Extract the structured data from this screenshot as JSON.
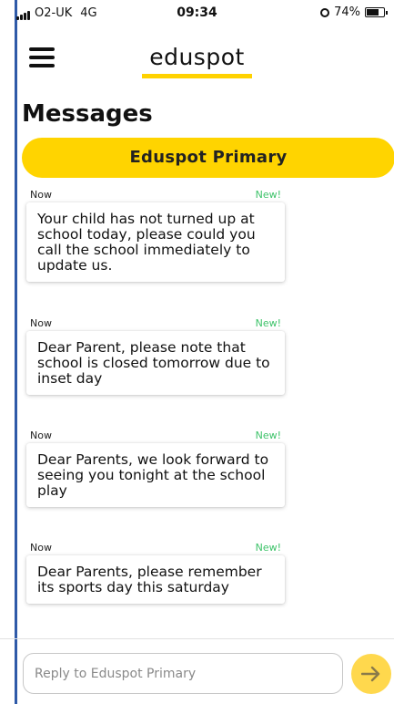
{
  "status_bar": {
    "carrier": "O2-UK",
    "network": "4G",
    "time": "09:34",
    "battery": "74%",
    "battery_level": 0.74
  },
  "header": {
    "logo": "eduspot",
    "menu_icon": "hamburger-menu-icon"
  },
  "page": {
    "title": "Messages",
    "school_name": "Eduspot Primary"
  },
  "messages": [
    {
      "time": "Now",
      "badge": "New!",
      "text": "Your child has not turned up at school today, please could you call the school immediate­ly to update us."
    },
    {
      "time": "Now",
      "badge": "New!",
      "text": "Dear Parent, please note that school is closed tomorrow due to inset day"
    },
    {
      "time": "Now",
      "badge": "New!",
      "text": "Dear Parents, we look for­ward to seeing you tonight at the school play"
    },
    {
      "time": "Now",
      "badge": "New!",
      "text": "Dear Parents, please remem­ber its sports day this satur­day"
    }
  ],
  "reply": {
    "placeholder": "Reply to Eduspot Primary",
    "value": "",
    "send_icon": "arrow-right-icon"
  },
  "colors": {
    "accent": "#ffd400",
    "new_badge": "#3ec36a",
    "send_button": "#ffd84d"
  }
}
